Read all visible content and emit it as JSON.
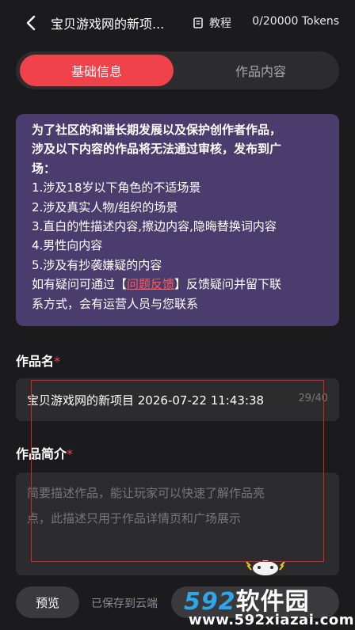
{
  "header": {
    "title": "宝贝游戏网的新项...",
    "tutorial_label": "教程",
    "tokens": "0/20000 Tokens"
  },
  "tabs": [
    {
      "label": "基础信息",
      "active": true
    },
    {
      "label": "作品内容",
      "active": false
    }
  ],
  "notice": {
    "heading_line1": "为了社区的和谐长期发展以及保护创作者作品，",
    "heading_line2": "涉及以下内容的作品将无法通过审核，发布到广",
    "heading_line3": "场：",
    "items": [
      "1.涉及18岁以下角色的不适场景",
      "2.涉及真实人物/组织的场景",
      "3.直白的性描述内容,擦边内容,隐晦替换词内容",
      "4.男性向内容",
      "5.涉及有抄袭嫌疑的内容"
    ],
    "footer_prefix": "如有疑问可通过【",
    "footer_link": "问题反馈",
    "footer_suffix": "】反馈疑问并留下联",
    "footer_line2": "系方式，会有运营人员与您联系"
  },
  "name_field": {
    "label": "作品名",
    "required_mark": "*",
    "value": "宝贝游戏网的新项目 2026-07-22 11:43:38",
    "counter": "29/40"
  },
  "desc_field": {
    "label": "作品简介",
    "required_mark": "*",
    "placeholder_line1": "简要描述作品，能让玩家可以快速了解作品亮",
    "placeholder_line2": "点，此描述只用于作品详情页和广场展示"
  },
  "bottom": {
    "preview_label": "预览",
    "saved_status": "已保存到云端"
  },
  "watermark": {
    "nums": "592",
    "text": "软件园",
    "url": "www.592xiazai.com"
  },
  "colors": {
    "background": "#1b1b1d",
    "accent": "#f0424a",
    "notice_bg": "#4a3d6e",
    "input_bg": "#2c2c2e"
  }
}
